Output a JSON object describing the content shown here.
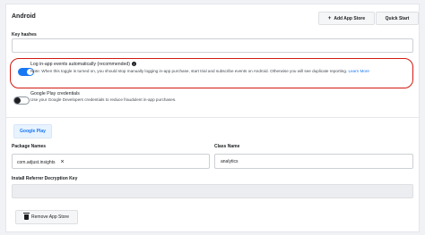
{
  "header": {
    "title": "Android",
    "add_app_store_label": "Add App Store",
    "add_icon_glyph": "+",
    "quick_start_label": "Quick Start"
  },
  "key_hashes": {
    "label": "Key hashes",
    "value": ""
  },
  "options": [
    {
      "title": "Log in-app events automatically (recommended)",
      "info_glyph": "i",
      "description": "Note: When this toggle is turned on, you should stop manually logging in-app purchase, start trial and subscribe events on Android. Otherwise you will see duplicate reporting.",
      "link": "Learn More",
      "enabled": true
    },
    {
      "title": "Google Play credentials",
      "description": "Use your Google Developers credentials to reduce fraudulent in-app purchases.",
      "enabled": false
    }
  ],
  "store": {
    "tab_label": "Google Play",
    "package_names_label": "Package Names",
    "package_names": [
      "com.adjust.insights"
    ],
    "remove_glyph": "×",
    "class_name_label": "Class Name",
    "class_name_value": "analytics",
    "decryption_key_label": "Install Referrer Decryption Key",
    "decryption_key_value": "",
    "remove_store_label": "Remove App Store"
  }
}
